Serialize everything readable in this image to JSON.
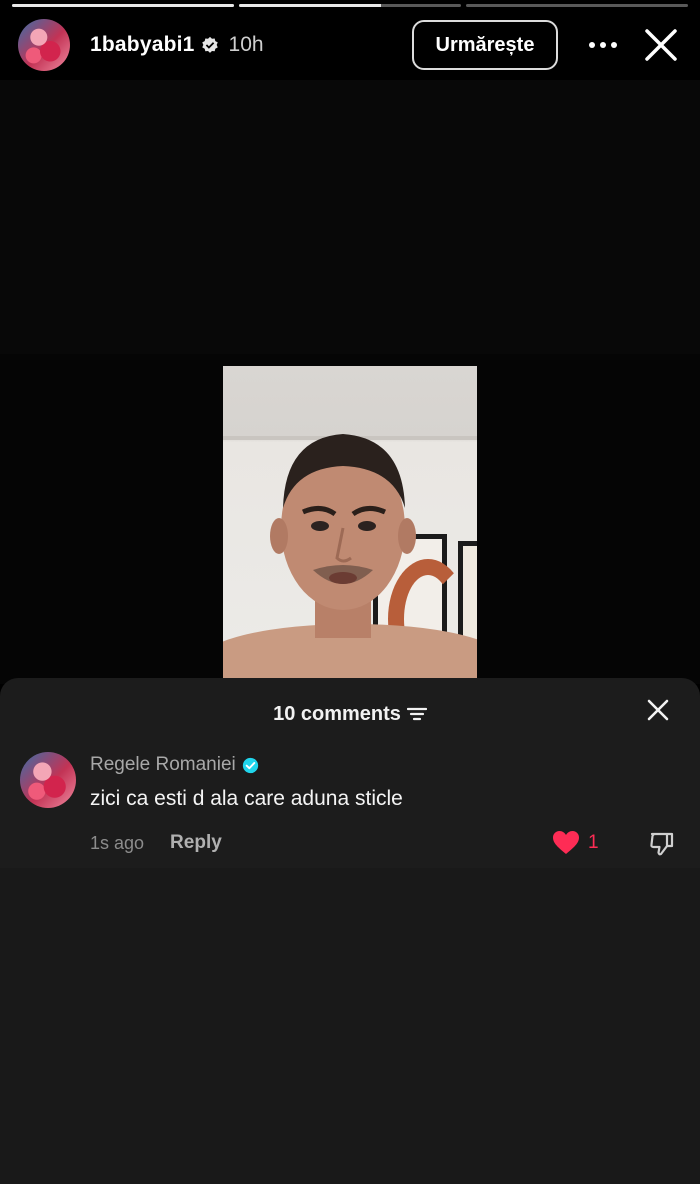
{
  "story": {
    "progress": [
      1.0,
      0.64,
      0.0
    ],
    "username": "1babyabi1",
    "time": "10h",
    "follow_label": "Urmărește",
    "more_icon": "more-horizontal-icon",
    "close_icon": "close-icon"
  },
  "comments_sheet": {
    "count_label": "10 comments",
    "comments": [
      {
        "author": "Regele Romaniei",
        "verified": true,
        "text": "zici ca esti d ala care aduna sticle",
        "time": "1s ago",
        "reply_label": "Reply",
        "likes": "1",
        "liked": true
      }
    ]
  },
  "colors": {
    "like": "#fe2c55",
    "verified_badge": "#20d5ec",
    "sheet_bg": "#1c1c1c"
  }
}
